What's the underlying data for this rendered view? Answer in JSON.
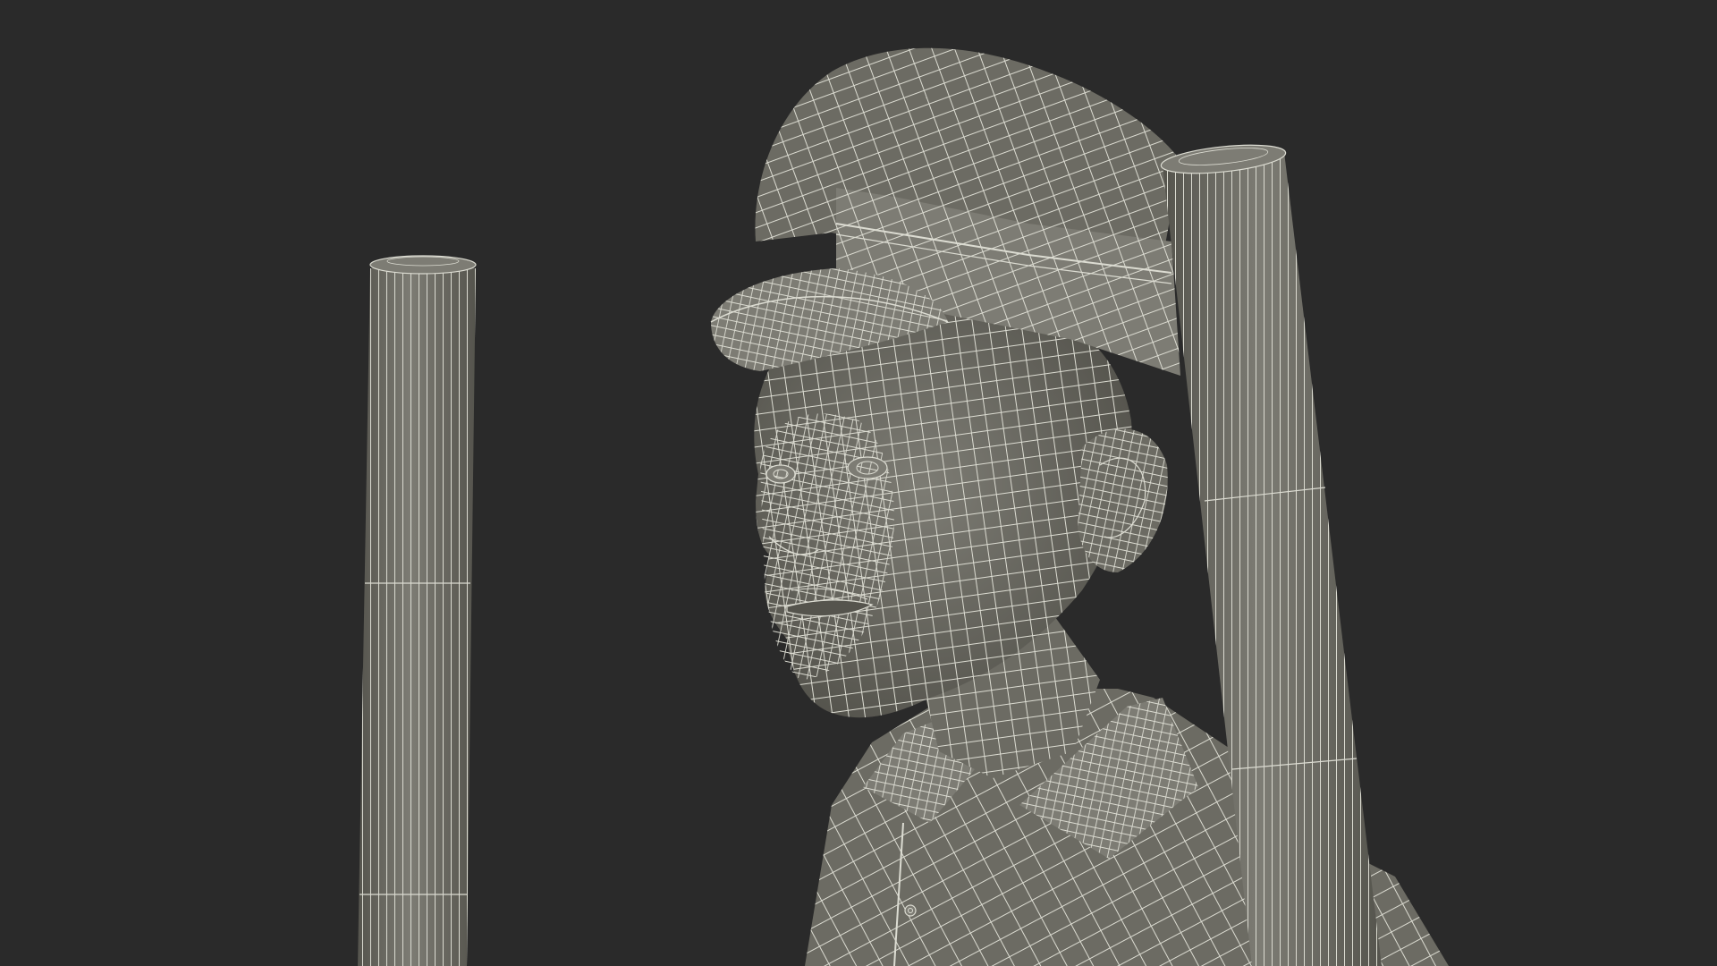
{
  "scene": {
    "background_color": "#2a2a2a",
    "mesh_fill_color": "#6c6b63",
    "mesh_fill_dark": "#55544d",
    "mesh_fill_light": "#7d7c74",
    "wireframe_color": "#dcdcd2"
  }
}
